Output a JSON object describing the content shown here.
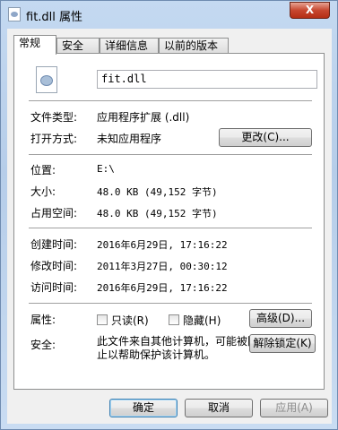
{
  "window": {
    "title": "fit.dll 属性",
    "close_label": "X"
  },
  "tabs": [
    {
      "label": "常规"
    },
    {
      "label": "安全"
    },
    {
      "label": "详细信息"
    },
    {
      "label": "以前的版本"
    }
  ],
  "general": {
    "file_name": "fit.dll",
    "file_type_label": "文件类型:",
    "file_type_value": "应用程序扩展 (.dll)",
    "open_with_label": "打开方式:",
    "open_with_value": "未知应用程序",
    "change_button": "更改(C)...",
    "location_label": "位置:",
    "location_value": "E:\\",
    "size_label": "大小:",
    "size_value": "48.0 KB (49,152 字节)",
    "size_on_disk_label": "占用空间:",
    "size_on_disk_value": "48.0 KB (49,152 字节)",
    "created_label": "创建时间:",
    "created_value": "2016年6月29日, 17:16:22",
    "modified_label": "修改时间:",
    "modified_value": "2011年3月27日, 00:30:12",
    "accessed_label": "访问时间:",
    "accessed_value": "2016年6月29日, 17:16:22",
    "attributes_label": "属性:",
    "readonly_label": "只读(R)",
    "hidden_label": "隐藏(H)",
    "advanced_button": "高级(D)...",
    "security_label": "安全:",
    "security_text": "此文件来自其他计算机，可能被阻止以帮助保护该计算机。",
    "unblock_button": "解除锁定(K)"
  },
  "footer": {
    "ok": "确定",
    "cancel": "取消",
    "apply": "应用(A)"
  }
}
